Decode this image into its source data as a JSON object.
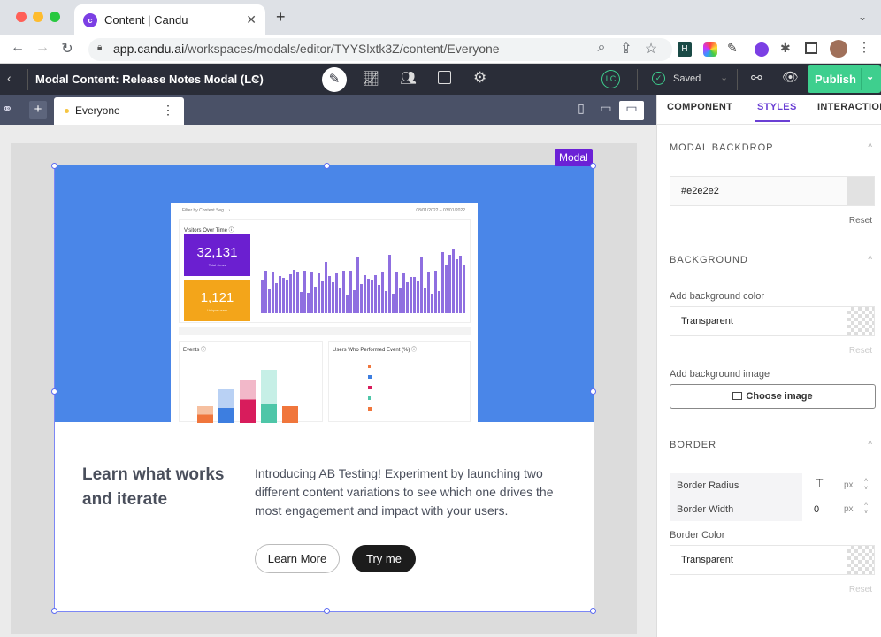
{
  "browser": {
    "tab_title": "Content | Candu",
    "url_domain": "app.candu.ai",
    "url_path": "/workspaces/modals/editor/TYYSlxtk3Z/content/Everyone"
  },
  "app": {
    "title": "Modal Content: Release Notes Modal (LC)",
    "avatar_initials": "LC",
    "saved_label": "Saved",
    "publish_label": "Publish",
    "segment_label": "Everyone"
  },
  "canvas": {
    "modal_badge": "Modal",
    "hero_color": "#4a86e8",
    "dashboard": {
      "filter": "Filter by Content Seg... ›",
      "dates": "08/01/2022 – 03/01/2022",
      "chart_title": "Visitors Over Time ⓘ",
      "stat1_value": "32,131",
      "stat1_label": "Total views",
      "stat2_value": "1,121",
      "stat2_label": "Unique users",
      "events_title": "Events ⓘ",
      "users_title": "Users Who Performed Event (%) ⓘ"
    },
    "heading": "Learn what works and iterate",
    "body": "Introducing AB Testing! Experiment by launching two different content variations to see which one drives the most engagement and impact with your users.",
    "learn_more": "Learn More",
    "try_me": "Try me"
  },
  "panel": {
    "tabs": [
      "COMPONENT",
      "STYLES",
      "INTERACTIONS"
    ],
    "backdrop_title": "MODAL BACKDROP",
    "backdrop_color": "#e2e2e2",
    "reset": "Reset",
    "background_title": "BACKGROUND",
    "add_bg_color": "Add background color",
    "bg_color_value": "Transparent",
    "add_bg_image": "Add background image",
    "choose_image": "Choose image",
    "border_title": "BORDER",
    "border_radius_label": "Border Radius",
    "border_radius_value": "",
    "border_width_label": "Border Width",
    "border_width_value": "0",
    "unit": "px",
    "border_color_label": "Border Color",
    "border_color_value": "Transparent"
  },
  "colors": {
    "accent": "#4a90e2",
    "publish": "#3ecf8e",
    "modal_badge": "#6b21d6",
    "tab_active": "#6a3fd4"
  }
}
